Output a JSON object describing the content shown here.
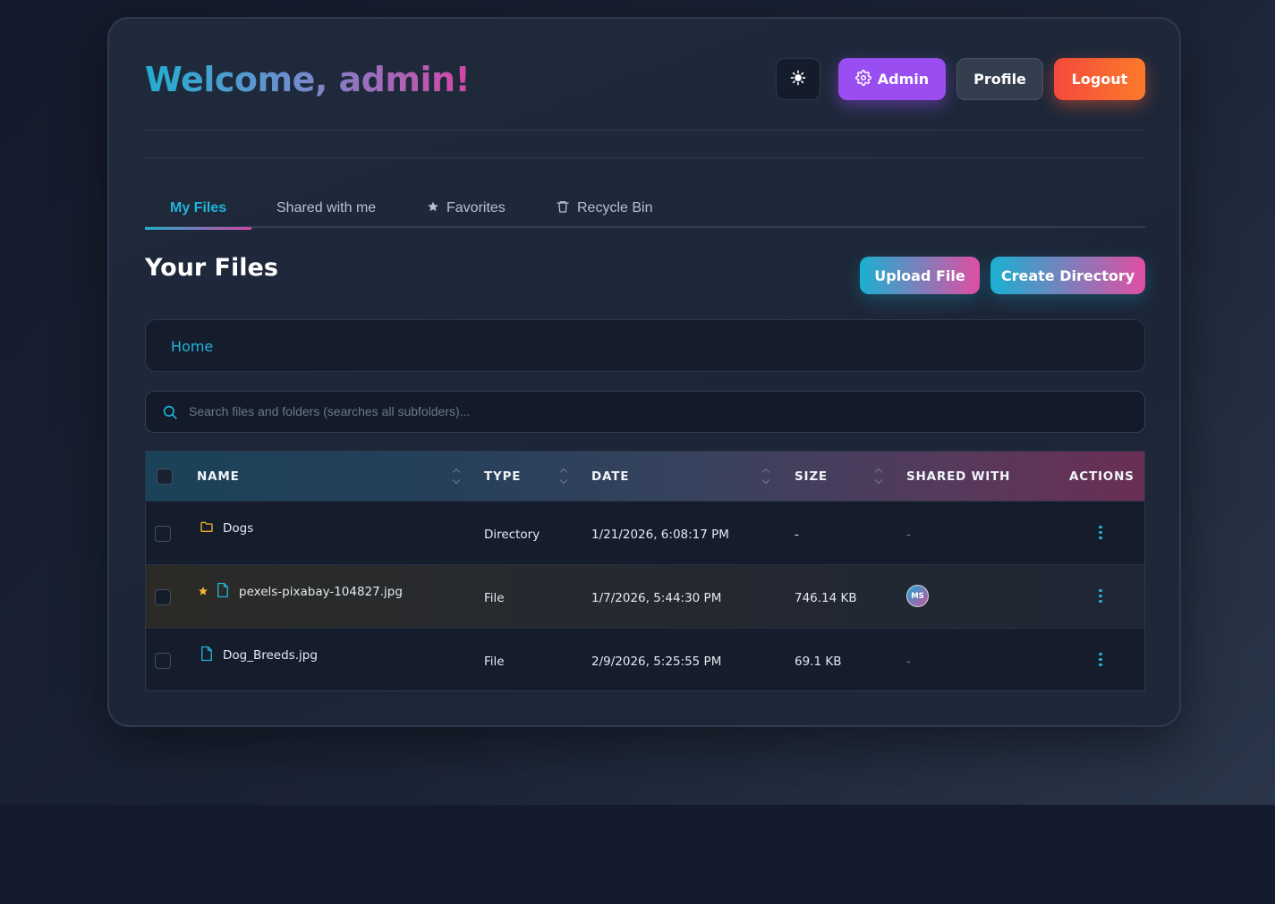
{
  "header": {
    "welcome": "Welcome, admin!",
    "theme_icon": "sun-icon",
    "admin_label": "Admin",
    "admin_icon": "gear-icon",
    "profile_label": "Profile",
    "logout_label": "Logout"
  },
  "tabs": [
    {
      "label": "My Files",
      "icon": "",
      "active": true
    },
    {
      "label": "Shared with me",
      "icon": "",
      "active": false
    },
    {
      "label": "Favorites",
      "icon": "star-icon",
      "active": false
    },
    {
      "label": "Recycle Bin",
      "icon": "trash-icon",
      "active": false
    }
  ],
  "main": {
    "title": "Your Files",
    "upload_label": "Upload File",
    "create_label": "Create Directory"
  },
  "breadcrumb": {
    "home": "Home"
  },
  "search": {
    "placeholder": "Search files and folders (searches all subfolders)...",
    "value": ""
  },
  "table": {
    "headers": {
      "name": "NAME",
      "type": "TYPE",
      "date": "DATE",
      "size": "SIZE",
      "shared": "SHARED WITH",
      "actions": "ACTIONS"
    },
    "rows": [
      {
        "name": "Dogs",
        "icon": "folder-icon",
        "favorite": false,
        "type": "Directory",
        "date": "1/21/2026, 6:08:17 PM",
        "size": "-",
        "shared": "-"
      },
      {
        "name": "pexels-pixabay-104827.jpg",
        "icon": "file-icon",
        "favorite": true,
        "type": "File",
        "date": "1/7/2026, 5:44:30 PM",
        "size": "746.14 KB",
        "shared": "MS"
      },
      {
        "name": "Dog_Breeds.jpg",
        "icon": "file-icon",
        "favorite": false,
        "type": "File",
        "date": "2/9/2026, 5:25:55 PM",
        "size": "69.1 KB",
        "shared": "-"
      }
    ]
  },
  "colors": {
    "accent_cyan": "#22b3d8",
    "accent_pink": "#d546a6",
    "admin_purple": "#9a4df0",
    "logout_orange": "#f55a36",
    "favorite_star": "#f5b72a",
    "folder_yellow": "#f5b72a"
  }
}
